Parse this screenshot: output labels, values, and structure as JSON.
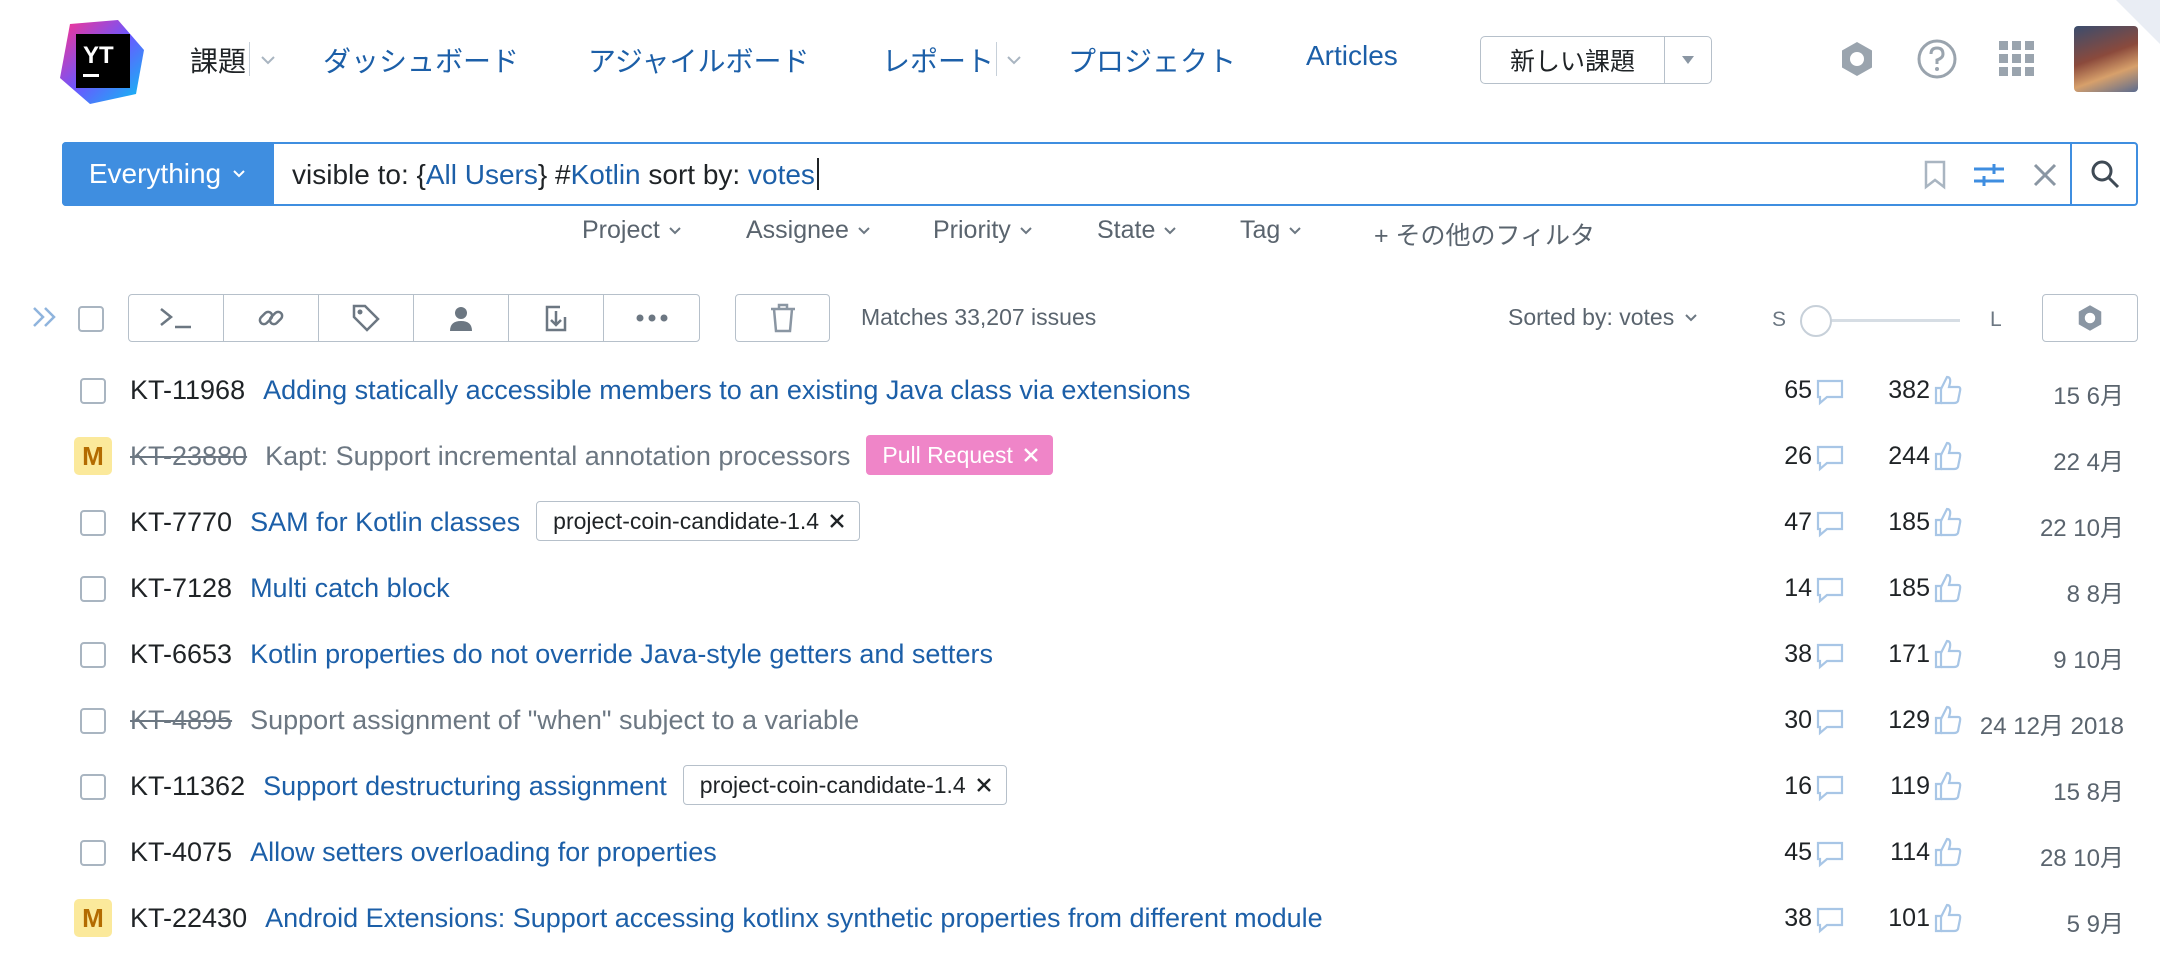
{
  "header": {
    "logo_text": "YT",
    "nav": [
      {
        "label": "課題",
        "has_menu": true
      },
      {
        "label": "ダッシュボード"
      },
      {
        "label": "アジャイルボード"
      },
      {
        "label": "レポート",
        "has_menu": true
      },
      {
        "label": "プロジェクト"
      },
      {
        "label": "Articles"
      }
    ],
    "new_issue_label": "新しい課題",
    "icons": [
      "settings-icon",
      "help-icon",
      "apps-grid-icon"
    ],
    "accent_color": "#3f8ee0",
    "link_color": "#1c5fa8"
  },
  "search": {
    "context_label": "Everything",
    "query_parts": [
      {
        "text": "visible to: {",
        "token": false
      },
      {
        "text": "All Users",
        "token": true
      },
      {
        "text": "} #",
        "token": false
      },
      {
        "text": "Kotlin",
        "token": true
      },
      {
        "text": " sort by: ",
        "token": false
      },
      {
        "text": "votes",
        "token": true
      }
    ]
  },
  "filters": [
    "Project",
    "Assignee",
    "Priority",
    "State",
    "Tag",
    "+ その他のフィルタ"
  ],
  "toolbar": {
    "matches_text": "Matches 33,207 issues",
    "sorted_text": "Sorted by: votes",
    "size_small": "S",
    "size_large": "L",
    "size_level": 0
  },
  "issues": [
    {
      "id": "KT-11968",
      "summary": "Adding statically accessible members to an existing Java class via extensions",
      "resolved": false,
      "mark": "",
      "tag": "",
      "tag_type": "",
      "comments": "65",
      "votes": "382",
      "date": "15 6月"
    },
    {
      "id": "KT-23880",
      "summary": "Kapt: Support incremental annotation processors",
      "resolved": true,
      "mark": "M",
      "tag": "Pull Request",
      "tag_type": "pr",
      "comments": "26",
      "votes": "244",
      "date": "22 4月"
    },
    {
      "id": "KT-7770",
      "summary": "SAM for Kotlin classes",
      "resolved": false,
      "mark": "",
      "tag": "project-coin-candidate-1.4",
      "tag_type": "coin",
      "comments": "47",
      "votes": "185",
      "date": "22 10月"
    },
    {
      "id": "KT-7128",
      "summary": "Multi catch block",
      "resolved": false,
      "mark": "",
      "tag": "",
      "tag_type": "",
      "comments": "14",
      "votes": "185",
      "date": "8 8月"
    },
    {
      "id": "KT-6653",
      "summary": "Kotlin properties do not override Java-style getters and setters",
      "resolved": false,
      "mark": "",
      "tag": "",
      "tag_type": "",
      "comments": "38",
      "votes": "171",
      "date": "9 10月"
    },
    {
      "id": "KT-4895",
      "summary": "Support assignment of \"when\" subject to a variable",
      "resolved": true,
      "mark": "",
      "tag": "",
      "tag_type": "",
      "comments": "30",
      "votes": "129",
      "date": "24 12月 2018"
    },
    {
      "id": "KT-11362",
      "summary": "Support destructuring assignment",
      "resolved": false,
      "mark": "",
      "tag": "project-coin-candidate-1.4",
      "tag_type": "coin",
      "comments": "16",
      "votes": "119",
      "date": "15 8月"
    },
    {
      "id": "KT-4075",
      "summary": "Allow setters overloading for properties",
      "resolved": false,
      "mark": "",
      "tag": "",
      "tag_type": "",
      "comments": "45",
      "votes": "114",
      "date": "28 10月"
    },
    {
      "id": "KT-22430",
      "summary": "Android Extensions: Support accessing kotlinx synthetic properties from different module",
      "resolved": false,
      "mark": "M",
      "tag": "",
      "tag_type": "",
      "comments": "38",
      "votes": "101",
      "date": "5 9月"
    }
  ]
}
